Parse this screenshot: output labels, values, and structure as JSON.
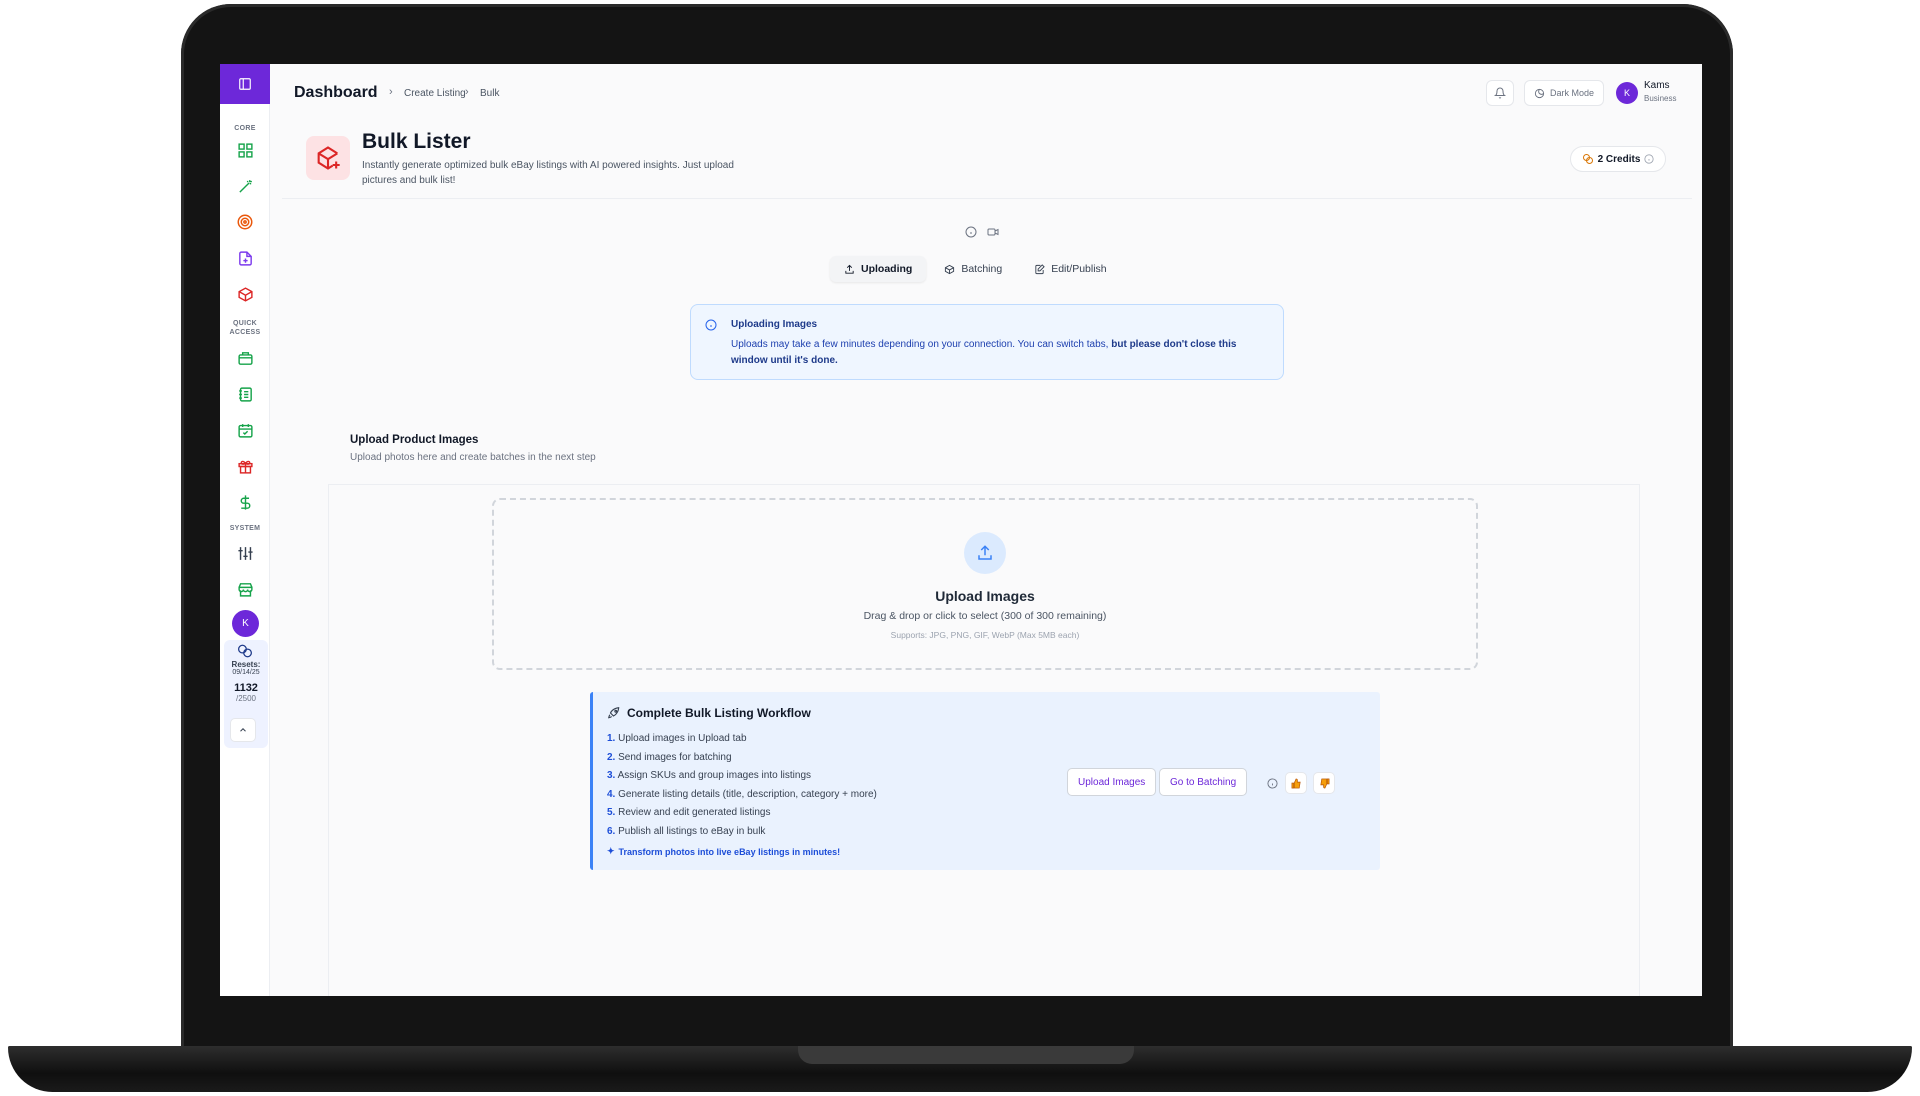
{
  "header": {
    "title": "Dashboard",
    "breadcrumb": [
      "Create Listing",
      "Bulk"
    ],
    "dark_mode_label": "Dark Mode",
    "user": {
      "initial": "K",
      "name": "Kams",
      "plan": "Business"
    }
  },
  "sidebar": {
    "sections": {
      "core": "CORE",
      "quick_access_1": "QUICK",
      "quick_access_2": "ACCESS",
      "system": "SYSTEM"
    },
    "core_items": [
      "dashboard-icon",
      "magic-wand-icon",
      "target-icon",
      "file-plus-icon",
      "package-plus-icon"
    ],
    "quick_items": [
      "store-icon",
      "notebook-icon",
      "calendar-check-icon",
      "gift-icon",
      "dollar-icon"
    ],
    "system_items": [
      "sliders-icon",
      "storefront-icon"
    ],
    "avatar_initial": "K",
    "usage": {
      "resets_label": "Resets:",
      "resets_date": "09/14/25",
      "used": "1132",
      "limit": "/2500"
    }
  },
  "page": {
    "title": "Bulk Lister",
    "subtitle": "Instantly generate optimized bulk eBay listings with AI powered insights. Just upload pictures and bulk list!",
    "credits": "2 Credits"
  },
  "tabs": [
    {
      "label": "Uploading",
      "icon": "upload-icon",
      "active": true
    },
    {
      "label": "Batching",
      "icon": "box-icon",
      "active": false
    },
    {
      "label": "Edit/Publish",
      "icon": "edit-icon",
      "active": false
    }
  ],
  "info": {
    "title": "Uploading Images",
    "text": "Uploads may take a few minutes depending on your connection. You can switch tabs,",
    "bold": "but please don't close this window until it's done."
  },
  "upload": {
    "section_title": "Upload Product Images",
    "section_subtitle": "Upload photos here and create batches in the next step",
    "title": "Upload Images",
    "subtitle": "Drag & drop or click to select (300 of 300 remaining)",
    "note": "Supports: JPG, PNG, GIF, WebP (Max 5MB each)"
  },
  "workflow": {
    "title": "Complete Bulk Listing Workflow",
    "steps": [
      {
        "n": "1.",
        "text": "Upload images in Upload tab"
      },
      {
        "n": "2.",
        "text": "Send images for batching"
      },
      {
        "n": "3.",
        "text": "Assign SKUs and group images into listings"
      },
      {
        "n": "4.",
        "text": "Generate listing details (title, description, category + more)"
      },
      {
        "n": "5.",
        "text": "Review and edit generated listings"
      },
      {
        "n": "6.",
        "text": "Publish all listings to eBay in bulk"
      }
    ],
    "footer": "Transform photos into live eBay listings in minutes!",
    "btn_upload": "Upload Images",
    "btn_batching": "Go to Batching"
  },
  "colors": {
    "accent": "#6d28d9",
    "info_bg": "#eff6ff",
    "workflow_bg": "#eaf2fe",
    "link": "#1d4ed8"
  }
}
